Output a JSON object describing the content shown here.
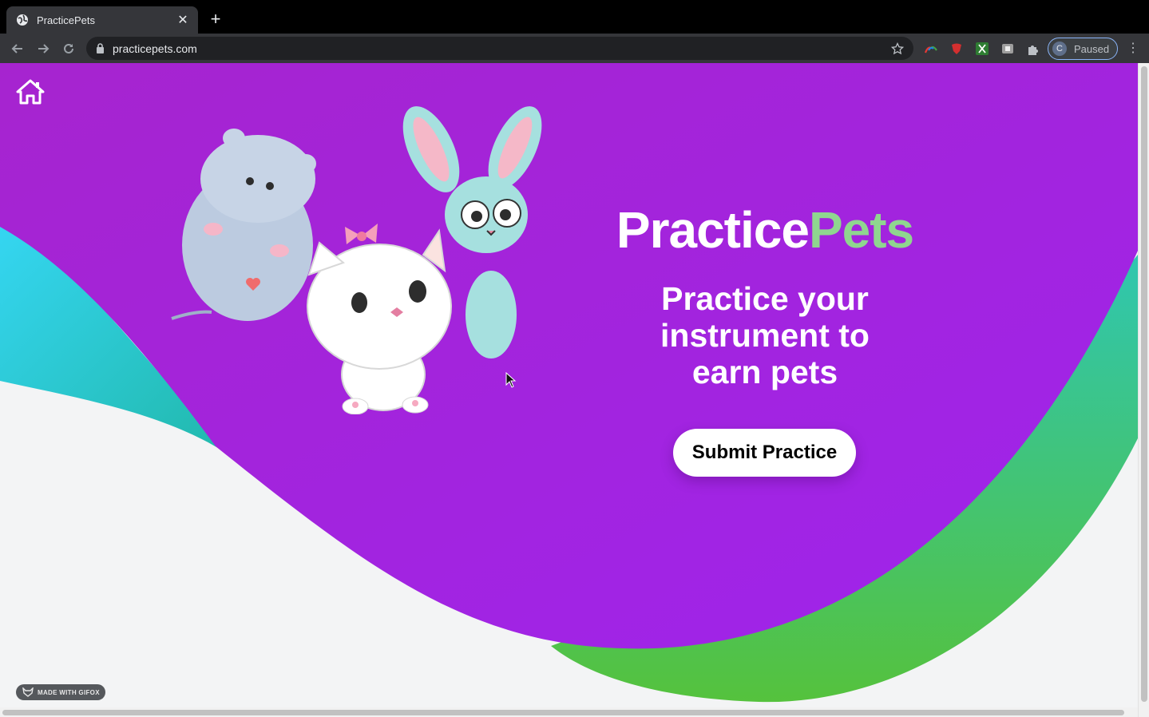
{
  "browser": {
    "tab_title": "PracticePets",
    "tab_close": "✕",
    "new_tab": "+",
    "url": "practicepets.com",
    "profile_initial": "C",
    "profile_status": "Paused",
    "menu_glyph": "⋮"
  },
  "page": {
    "brand_part1": "Practice",
    "brand_part2": "Pets",
    "tagline": "Practice your instrument to earn pets",
    "cta_label": "Submit Practice",
    "watermark": "MADE WITH GIFOX"
  },
  "colors": {
    "purple": "#a323dd",
    "teal": "#2fd0e0",
    "green": "#4cc44a",
    "brand_accent": "#8fd68f",
    "page_bg": "#f3f4f5"
  },
  "icons": {
    "home": "home-icon",
    "back": "arrow-left-icon",
    "forward": "arrow-right-icon",
    "reload": "reload-icon",
    "lock": "lock-icon",
    "star": "star-icon",
    "extensions": "puzzle-icon"
  }
}
